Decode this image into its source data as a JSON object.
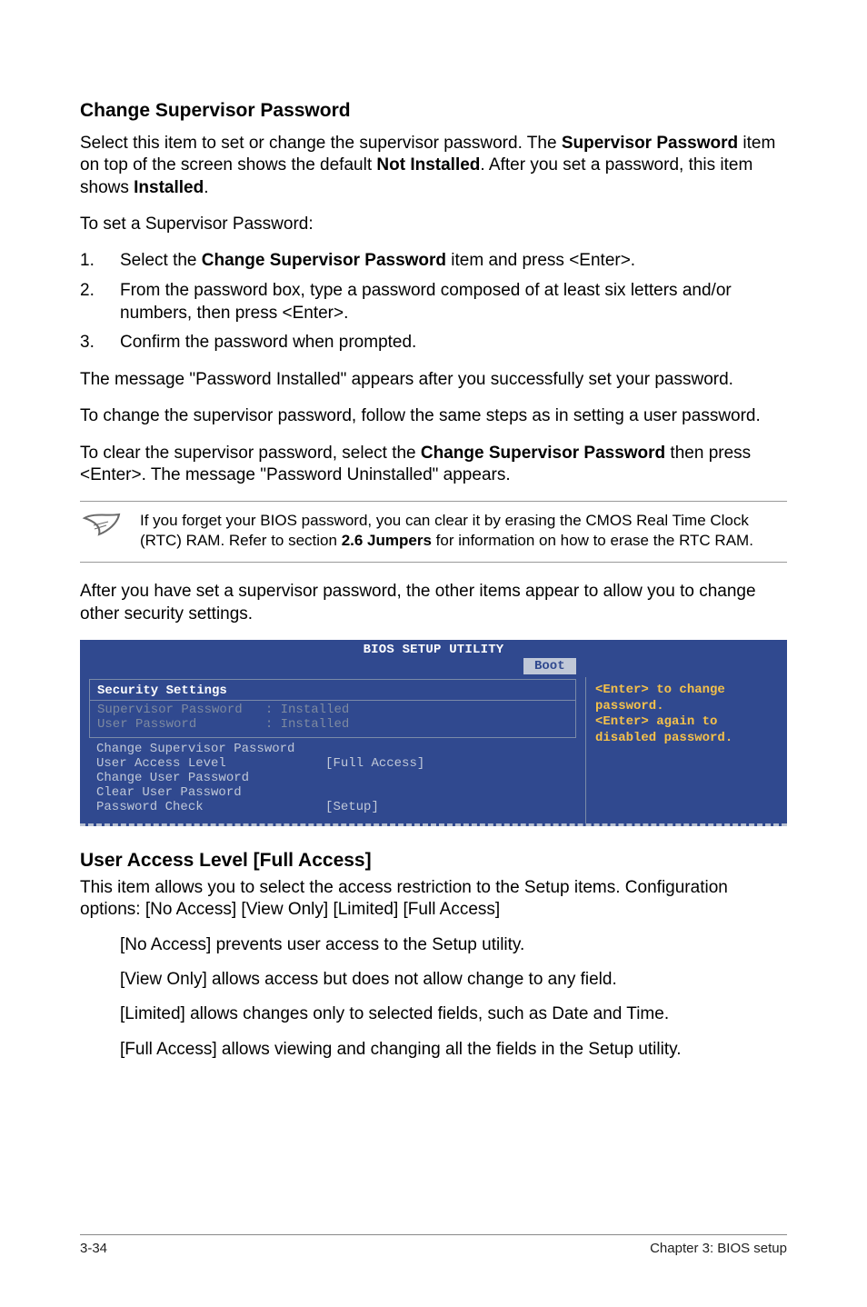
{
  "heading1": "Change Supervisor Password",
  "p1_a": "Select this item to set or change the supervisor password. The ",
  "p1_b": "Supervisor Password",
  "p1_c": " item on top of the screen shows the default ",
  "p1_d": "Not Installed",
  "p1_e": ". After you set a password, this item shows ",
  "p1_f": "Installed",
  "p1_g": ".",
  "p2": "To set a Supervisor Password:",
  "steps": [
    {
      "n": "1.",
      "pre": "Select the ",
      "bold": "Change Supervisor Password",
      "post": " item and press <Enter>."
    },
    {
      "n": "2.",
      "pre": "From the password box, type a password composed of at least six letters and/or numbers, then press <Enter>.",
      "bold": "",
      "post": ""
    },
    {
      "n": "3.",
      "pre": "Confirm the password when prompted.",
      "bold": "",
      "post": ""
    }
  ],
  "p3": "The message \"Password Installed\" appears after you successfully set your password.",
  "p4": "To change the supervisor password, follow the same steps as in setting a user password.",
  "p5_a": "To clear the supervisor password, select the ",
  "p5_b": "Change Supervisor Password",
  "p5_c": " then press <Enter>. The message \"Password Uninstalled\" appears.",
  "note_a": "If you forget your BIOS password, you can clear it by erasing the CMOS Real Time Clock (RTC) RAM. Refer to section ",
  "note_b": "2.6 Jumpers",
  "note_c": " for information on how to erase the RTC RAM.",
  "p6": "After you have set a supervisor password, the other items appear to allow you to change other security settings.",
  "bios": {
    "title": "BIOS SETUP UTILITY",
    "tab": "Boot",
    "section_title": "Security Settings",
    "status_rows": [
      "Supervisor Password   : Installed",
      "User Password         : Installed"
    ],
    "menu_rows": [
      "Change Supervisor Password",
      "User Access Level             [Full Access]",
      "Change User Password",
      "Clear User Password",
      "Password Check                [Setup]"
    ],
    "help": "<Enter> to change password.\n<Enter> again to disabled password."
  },
  "heading2": "User Access Level [Full Access]",
  "p7": "This item allows you to select the access restriction to the Setup items. Configuration options: [No Access] [View Only] [Limited] [Full Access]",
  "opts": [
    "[No Access] prevents user access to the Setup utility.",
    "[View Only] allows access but does not allow change to any field.",
    "[Limited] allows changes only to selected fields, such as Date and Time.",
    "[Full Access] allows viewing and changing all the fields in the Setup utility."
  ],
  "footer_left": "3-34",
  "footer_right": "Chapter 3: BIOS setup"
}
